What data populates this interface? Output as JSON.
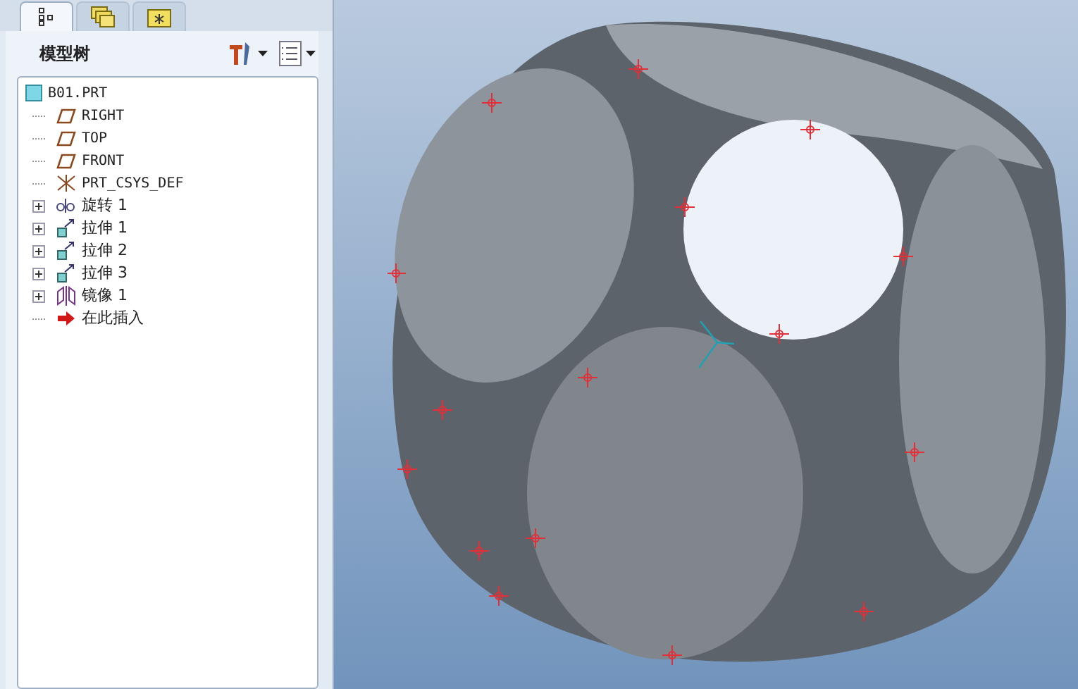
{
  "navigator_tabs": [
    {
      "kind": "tree",
      "selected": true
    },
    {
      "kind": "folders",
      "selected": false
    },
    {
      "kind": "favorites",
      "selected": false
    }
  ],
  "panel": {
    "title": "模型树"
  },
  "tree": {
    "label": "B01.PRT",
    "kind": "part",
    "children": [
      {
        "label": "RIGHT",
        "kind": "plane",
        "expandable": false
      },
      {
        "label": "TOP",
        "kind": "plane",
        "expandable": false
      },
      {
        "label": "FRONT",
        "kind": "plane",
        "expandable": false
      },
      {
        "label": "PRT_CSYS_DEF",
        "kind": "csys",
        "expandable": false
      },
      {
        "label": "旋转 1",
        "kind": "revolve",
        "expandable": true
      },
      {
        "label": "拉伸 1",
        "kind": "extrude",
        "expandable": true
      },
      {
        "label": "拉伸 2",
        "kind": "extrude",
        "expandable": true
      },
      {
        "label": "拉伸 3",
        "kind": "extrude",
        "expandable": true
      },
      {
        "label": "镜像 1",
        "kind": "mirror",
        "expandable": true
      },
      {
        "label": "在此插入",
        "kind": "insert",
        "expandable": false
      }
    ]
  }
}
